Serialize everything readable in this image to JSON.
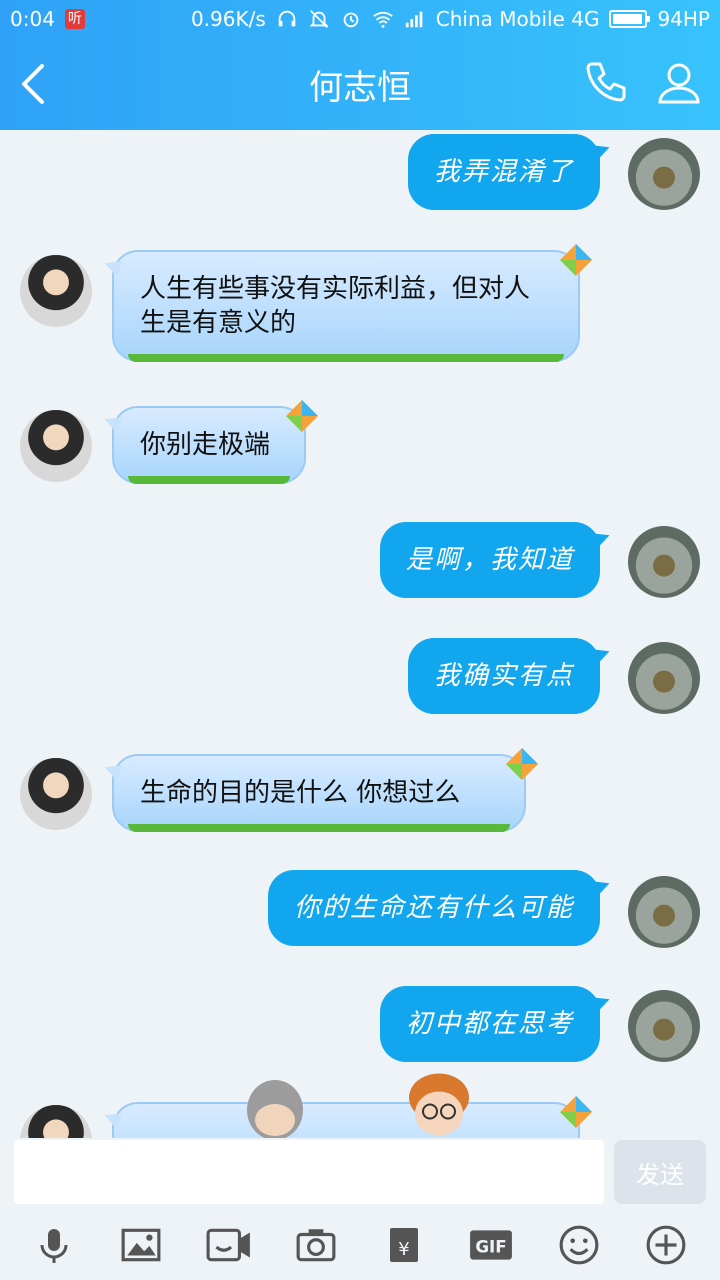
{
  "status_bar": {
    "time": "0:04",
    "badge": "听",
    "speed": "0.96K/s",
    "carrier": "China Mobile 4G",
    "battery": "94HP",
    "battery_level": 0.94
  },
  "header": {
    "title": "何志恒",
    "back_icon": "back-arrow-icon",
    "call_icon": "phone-icon",
    "profile_icon": "person-icon"
  },
  "messages": [
    {
      "from": "self",
      "text": "我弄混淆了"
    },
    {
      "from": "other",
      "text": "人生有些事没有实际利益，但对人生是有意义的"
    },
    {
      "from": "other",
      "text": "你别走极端"
    },
    {
      "from": "self",
      "text": "是啊，我知道"
    },
    {
      "from": "self",
      "text": "我确实有点"
    },
    {
      "from": "other",
      "text": "生命的目的是什么  你想过么"
    },
    {
      "from": "self",
      "text": "你的生命还有什么可能"
    },
    {
      "from": "self",
      "text": "初中都在思考"
    }
  ],
  "input": {
    "value": "",
    "send_label": "发送"
  },
  "toolbar": {
    "icons": [
      "microphone-icon",
      "image-icon",
      "video-call-icon",
      "camera-icon",
      "red-packet-icon",
      "gif-icon",
      "emoji-icon",
      "plus-icon"
    ],
    "gif_label": "GIF",
    "yuan_label": "¥"
  },
  "colors": {
    "header_start": "#2fa2f7",
    "header_end": "#37c3fb",
    "self_bubble": "#12a6ef",
    "other_bubble": "#b7dcfc",
    "background": "#eef3f8"
  }
}
